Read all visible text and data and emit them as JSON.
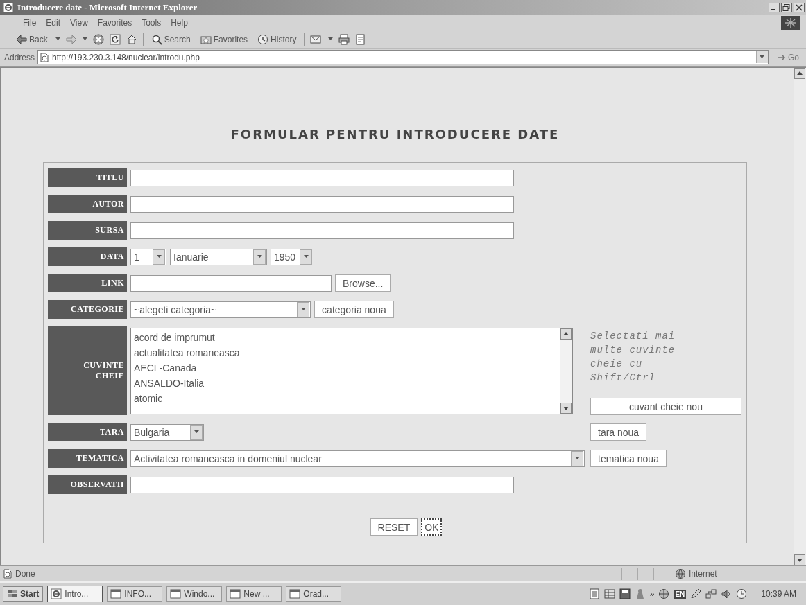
{
  "window": {
    "title": "Introducere date - Microsoft Internet Explorer"
  },
  "menu": [
    "File",
    "Edit",
    "View",
    "Favorites",
    "Tools",
    "Help"
  ],
  "toolbar": {
    "back": "Back",
    "buttons": [
      "Search",
      "Favorites",
      "History"
    ]
  },
  "address": {
    "label": "Address",
    "url": "http://193.230.3.148/nuclear/introdu.php",
    "go": "Go"
  },
  "form": {
    "title": "FORMULAR PENTRU INTRODUCERE DATE",
    "rows": [
      {
        "label": "TITLU",
        "kind": "text"
      },
      {
        "label": "AUTOR",
        "kind": "text"
      },
      {
        "label": "SURSA",
        "kind": "text"
      },
      {
        "label": "DATA",
        "kind": "date",
        "selects": [
          "1",
          "Ianuarie",
          "1950"
        ]
      },
      {
        "label": "LINK",
        "kind": "file",
        "button": "Browse..."
      },
      {
        "label": "CATEGORIE",
        "kind": "select",
        "value": "~alegeti categoria~",
        "button": "categoria noua"
      },
      {
        "label": "CUVINTE CHEIE",
        "kind": "list",
        "options": [
          {
            "text": "acord de imprumut",
            "selected": false
          },
          {
            "text": "actualitatea romaneasca",
            "selected": false
          },
          {
            "text": "AECL-Canada",
            "selected": false
          },
          {
            "text": "ANSALDO-Italia",
            "selected": false
          },
          {
            "text": "atomic",
            "selected": false
          }
        ],
        "hint": "Selectati mai multe cuvinte cheie cu Shift/Ctrl",
        "button": "cuvant cheie nou"
      },
      {
        "label": "TARA",
        "kind": "select",
        "value": "Bulgaria",
        "button": "tara noua"
      },
      {
        "label": "TEMATICA",
        "kind": "wideselect",
        "value": "Activitatea romaneasca in domeniul nuclear",
        "button": "tematica noua"
      },
      {
        "label": "OBSERVATII",
        "kind": "text"
      }
    ],
    "buttons": [
      {
        "label": "RESET",
        "focused": false
      },
      {
        "label": "OK",
        "focused": true
      }
    ]
  },
  "status_bar": {
    "text": "Done",
    "zone": "Internet"
  },
  "taskbar": {
    "start": "Start",
    "items": [
      {
        "label": "Intro...",
        "selected": true
      },
      {
        "label": "INFO...",
        "selected": false
      },
      {
        "label": "Windo...",
        "selected": false
      },
      {
        "label": "New ...",
        "selected": false
      },
      {
        "label": "Orad...",
        "selected": false
      }
    ],
    "chevron": "»",
    "language": "EN",
    "clock": "10:39 AM"
  }
}
